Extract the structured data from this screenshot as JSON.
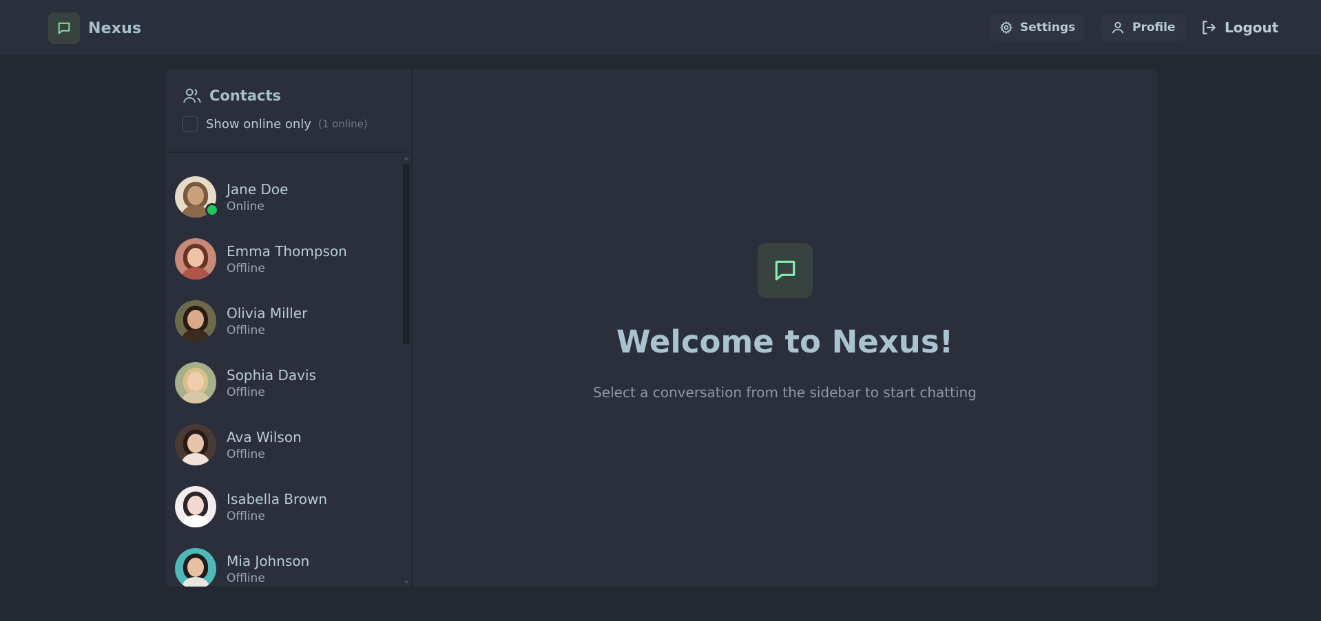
{
  "app": {
    "name": "Nexus"
  },
  "nav": {
    "settings_label": "Settings",
    "profile_label": "Profile",
    "logout_label": "Logout"
  },
  "sidebar": {
    "title": "Contacts",
    "online_toggle_label": "Show online only",
    "online_count": "(1 online)",
    "contacts": [
      {
        "name": "Jane Doe",
        "status": "Online"
      },
      {
        "name": "Emma Thompson",
        "status": "Offline"
      },
      {
        "name": "Olivia Miller",
        "status": "Offline"
      },
      {
        "name": "Sophia Davis",
        "status": "Offline"
      },
      {
        "name": "Ava Wilson",
        "status": "Offline"
      },
      {
        "name": "Isabella Brown",
        "status": "Offline"
      },
      {
        "name": "Mia Johnson",
        "status": "Offline"
      }
    ]
  },
  "main": {
    "welcome_title": "Welcome to Nexus!",
    "welcome_subtitle": "Select a conversation from the sidebar to start chatting"
  },
  "colors": {
    "accent": "#86efac",
    "background": "#232833",
    "panel": "#2a2f3b",
    "online": "#22c55e"
  }
}
